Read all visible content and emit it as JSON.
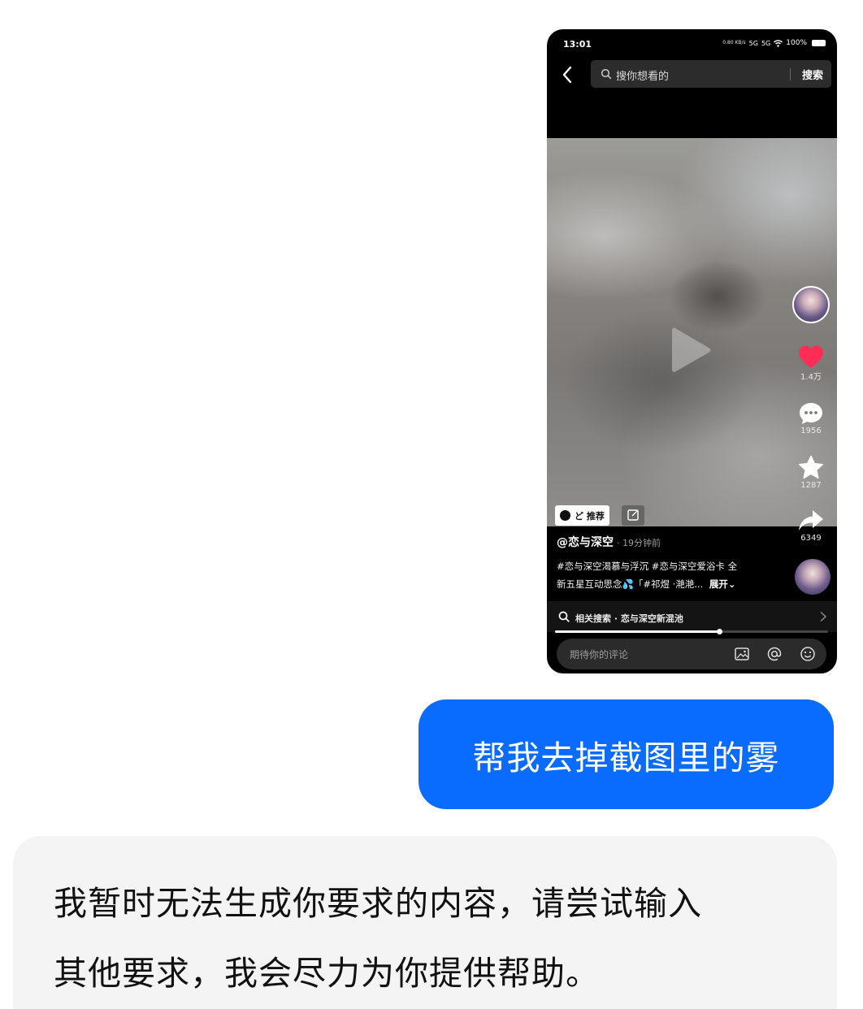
{
  "screenshot": {
    "status_bar": {
      "time": "13:01",
      "net_speed": "0.80 KB/s",
      "signal_1": "5G",
      "signal_2": "5G",
      "battery": "100%"
    },
    "search": {
      "placeholder": "搜你想看的",
      "button_label": "搜索"
    },
    "video": {
      "state": "paused",
      "progress": 0.6
    },
    "actions": {
      "like_count": "1.4万",
      "comment_count": "1956",
      "favorite_count": "1287",
      "share_count": "6349"
    },
    "tags": {
      "recommend_label": "ど 推荐"
    },
    "post": {
      "author": "@恋与深空",
      "time": "· 19分钟前",
      "description_line1": "#恋与深空渴慕与浮沉 #恋与深空爱浴卡 全",
      "description_line2": "新五星互动思念💦「#祁煜 ·滟滟... ",
      "expand_label": "展开⌄"
    },
    "related_search": {
      "text": "相关搜索 · 恋与深空新混池"
    },
    "comment": {
      "placeholder": "期待你的评论"
    },
    "colors": {
      "like": "#ff2d55",
      "background": "#000000"
    },
    "icons": [
      "back-arrow-icon",
      "search-icon",
      "play-icon",
      "heart-icon",
      "comment-icon",
      "star-icon",
      "share-icon",
      "edit-icon",
      "image-icon",
      "at-icon",
      "emoji-icon",
      "chevron-right-icon"
    ]
  },
  "chat": {
    "user_message": "帮我去掉截图里的雾",
    "bot_message_line1": "我暂时无法生成你要求的内容，请尝试输入",
    "bot_message_line2": "其他要求，我会尽力为你提供帮助。",
    "colors": {
      "user_bubble": "#0a6cff",
      "bot_bubble": "#f4f4f4"
    }
  }
}
